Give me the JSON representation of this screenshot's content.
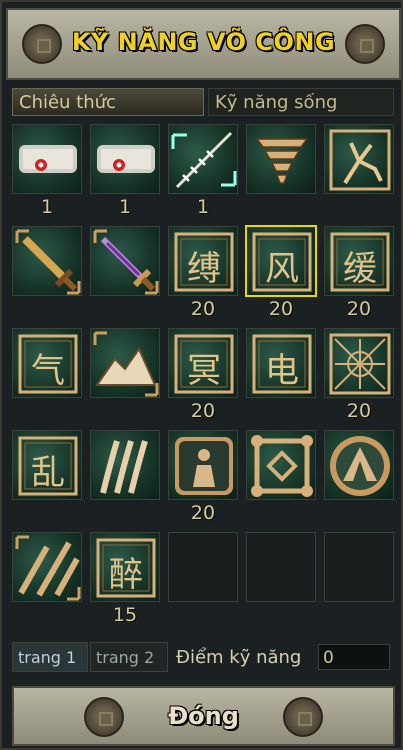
{
  "window": {
    "title": "KỸ NĂNG VÕ CÔNG",
    "close_label": "Đóng"
  },
  "tabs": [
    {
      "label": "Chiêu thức",
      "active": true
    },
    {
      "label": "Kỹ năng sống",
      "active": false
    }
  ],
  "skills": [
    {
      "icon": "scroll-icon",
      "level": "1"
    },
    {
      "icon": "scroll-icon",
      "level": "1"
    },
    {
      "icon": "arrows-icon",
      "level": "1"
    },
    {
      "icon": "tornado-icon",
      "level": ""
    },
    {
      "icon": "branch-icon",
      "level": ""
    },
    {
      "icon": "sword-icon",
      "level": ""
    },
    {
      "icon": "sword-purple-icon",
      "level": ""
    },
    {
      "icon": "glyph-icon",
      "glyph": "缚",
      "level": "20"
    },
    {
      "icon": "glyph-icon",
      "glyph": "风",
      "level": "20",
      "selected": true
    },
    {
      "icon": "glyph-icon",
      "glyph": "缓",
      "level": "20"
    },
    {
      "icon": "glyph-icon",
      "glyph": "气",
      "level": ""
    },
    {
      "icon": "mountain-icon",
      "level": ""
    },
    {
      "icon": "glyph-icon",
      "glyph": "冥",
      "level": "20"
    },
    {
      "icon": "glyph-icon",
      "glyph": "电",
      "level": ""
    },
    {
      "icon": "web-icon",
      "level": "20"
    },
    {
      "icon": "glyph-icon",
      "glyph": "乱",
      "level": ""
    },
    {
      "icon": "claw-icon",
      "level": ""
    },
    {
      "icon": "figure-icon",
      "level": "20"
    },
    {
      "icon": "diamond-icon",
      "level": ""
    },
    {
      "icon": "cone-icon",
      "level": ""
    },
    {
      "icon": "slash-icon",
      "level": ""
    },
    {
      "icon": "glyph-icon",
      "glyph": "醉",
      "level": "15"
    },
    {
      "icon": "empty",
      "level": ""
    },
    {
      "icon": "empty",
      "level": ""
    },
    {
      "icon": "empty",
      "level": ""
    }
  ],
  "footer": {
    "page_tabs": [
      {
        "label": "trang 1",
        "active": true
      },
      {
        "label": "trang 2",
        "active": false
      }
    ],
    "points_label": "Điểm kỹ năng",
    "points_value": "0"
  },
  "colors": {
    "title": "#f0d020",
    "selected_outline": "#e8d800",
    "level_text": "#d6cc9a"
  }
}
